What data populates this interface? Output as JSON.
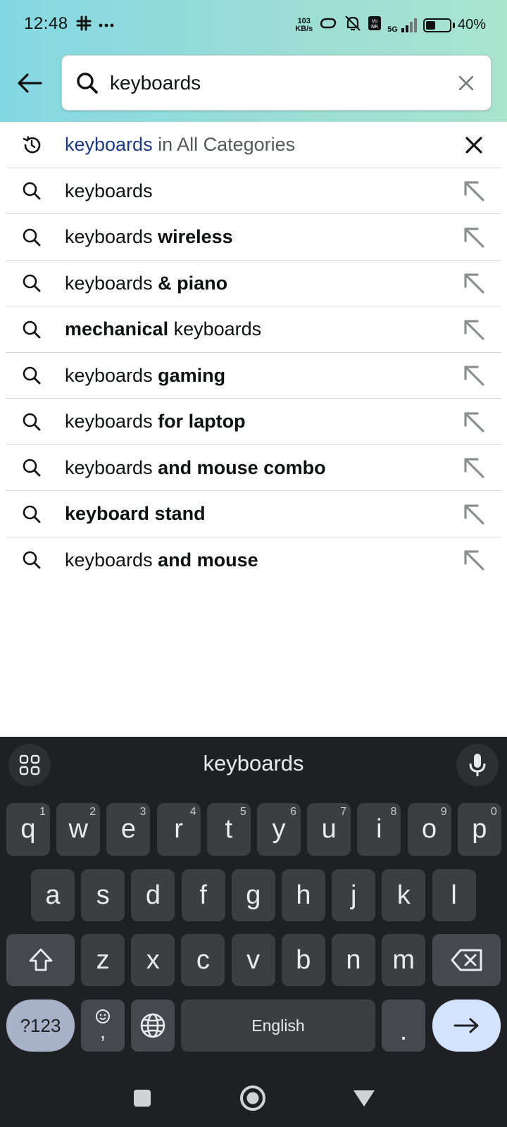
{
  "status_bar": {
    "time": "12:48",
    "net_speed_value": "103",
    "net_speed_unit": "KB/s",
    "network_type": "5G",
    "battery_percent": "40%",
    "battery_level": 0.4
  },
  "header": {
    "search_value": "keyboards",
    "accent_color": "#1b3a8a"
  },
  "history_suggestion": {
    "keyword": "keyboards",
    "rest": " in All Categories"
  },
  "suggestions": [
    {
      "plain_before": "keyboards",
      "bold": "",
      "plain_after": ""
    },
    {
      "plain_before": "keyboards ",
      "bold": "wireless",
      "plain_after": ""
    },
    {
      "plain_before": "keyboards ",
      "bold": "& piano",
      "plain_after": ""
    },
    {
      "plain_before": "",
      "bold": "mechanical",
      "plain_after": " keyboards"
    },
    {
      "plain_before": "keyboards ",
      "bold": "gaming",
      "plain_after": ""
    },
    {
      "plain_before": "keyboards ",
      "bold": "for laptop",
      "plain_after": ""
    },
    {
      "plain_before": "keyboards ",
      "bold": "and mouse combo",
      "plain_after": ""
    },
    {
      "plain_before": "",
      "bold": "keyboard stand",
      "plain_after": ""
    },
    {
      "plain_before": "keyboards ",
      "bold": "and mouse",
      "plain_after": ""
    }
  ],
  "keyboard": {
    "suggestion": "keyboards",
    "row1": [
      {
        "k": "q",
        "h": "1"
      },
      {
        "k": "w",
        "h": "2"
      },
      {
        "k": "e",
        "h": "3"
      },
      {
        "k": "r",
        "h": "4"
      },
      {
        "k": "t",
        "h": "5"
      },
      {
        "k": "y",
        "h": "6"
      },
      {
        "k": "u",
        "h": "7"
      },
      {
        "k": "i",
        "h": "8"
      },
      {
        "k": "o",
        "h": "9"
      },
      {
        "k": "p",
        "h": "0"
      }
    ],
    "row2": [
      "a",
      "s",
      "d",
      "f",
      "g",
      "h",
      "j",
      "k",
      "l"
    ],
    "row3": [
      "z",
      "x",
      "c",
      "v",
      "b",
      "n",
      "m"
    ],
    "num_key": "?123",
    "emoji_comma": ",",
    "space_label": "English",
    "period": "."
  }
}
